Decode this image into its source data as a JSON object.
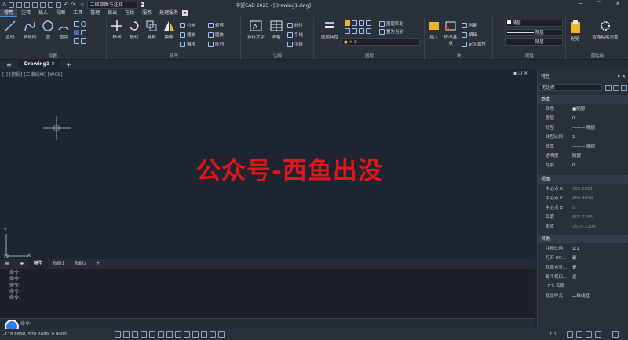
{
  "titlebar": {
    "workspace": "二维草图与注释",
    "app_title": "中望CAD 2025 - [Drawing1.dwg]"
  },
  "menu": [
    "常用",
    "注释",
    "插入",
    "视图",
    "工具",
    "管理",
    "输出",
    "在线",
    "服务",
    "处理服务"
  ],
  "ribbon": {
    "draw": {
      "label": "绘图",
      "tools": [
        "直线",
        "多段线",
        "圆",
        "圆弧"
      ]
    },
    "modify": {
      "label": "修改",
      "tools": [
        "移动",
        "旋转",
        "复制",
        "镜像"
      ],
      "small": [
        "拉伸",
        "修剪",
        "缩放",
        "圆角",
        "偏移",
        "阵列"
      ]
    },
    "annotation": {
      "label": "注释",
      "tools": [
        "多行文字",
        "表格"
      ],
      "small": [
        "线性",
        "引线",
        "字段"
      ]
    },
    "layers": {
      "label": "图层",
      "tool": "图层特性",
      "small": [
        "图层匹配",
        "置为当前"
      ],
      "current_layer": "0"
    },
    "block": {
      "label": "块",
      "tools": [
        "插入",
        "修改基点"
      ],
      "small": [
        "创建",
        "编辑",
        "定义属性"
      ]
    },
    "properties": {
      "label": "属性",
      "color": "随层",
      "linetype": "随层",
      "lineweight": "随层"
    },
    "clipboard": {
      "label": "剪贴板",
      "tool": "粘贴",
      "small": "智能粘贴设置"
    }
  },
  "doc_tab": "Drawing1",
  "viewport_label": "[-] [俯视] [二维线框] [WCS]",
  "watermark": "公众号-西鱼出没",
  "axis": {
    "x": "X",
    "y": "Y"
  },
  "layout_tabs": [
    "模型",
    "布局1",
    "布局2",
    "+"
  ],
  "command_history": [
    "命令:",
    "命令:",
    "命令:",
    "命令:",
    "命令:"
  ],
  "command_prompt": "命令:",
  "status": {
    "coords": "-118.8898, 570.2689, 0.0000",
    "scale": "1:1"
  },
  "properties_panel": {
    "title": "特性",
    "selection": "无选择",
    "basic_header": "基本",
    "basic": [
      [
        "颜色",
        "■随层"
      ],
      [
        "图层",
        "0"
      ],
      [
        "线型",
        "——— 随层"
      ],
      [
        "线型比例",
        "1"
      ],
      [
        "线宽",
        "——— 随层"
      ],
      [
        "透明度",
        "随层"
      ],
      [
        "厚度",
        "0"
      ]
    ],
    "view_header": "视图",
    "view": [
      [
        "中心点 X",
        "555.8901"
      ],
      [
        "中心点 Y",
        "450.4994"
      ],
      [
        "中心点 Z",
        "0"
      ],
      [
        "高度",
        "607.7385"
      ],
      [
        "宽度",
        "2524.2208"
      ]
    ],
    "misc_header": "其他",
    "misc": [
      [
        "注释比例",
        "1:1"
      ],
      [
        "打开 UC...",
        "是"
      ],
      [
        "在原点显...",
        "是"
      ],
      [
        "每个视口...",
        "是"
      ],
      [
        "UCS 名称",
        ""
      ],
      [
        "视觉样式",
        "二维线框"
      ]
    ]
  },
  "colors": {
    "accent": "#4a90e2",
    "watermark": "#e3141b",
    "canvas": "#1e2530"
  }
}
